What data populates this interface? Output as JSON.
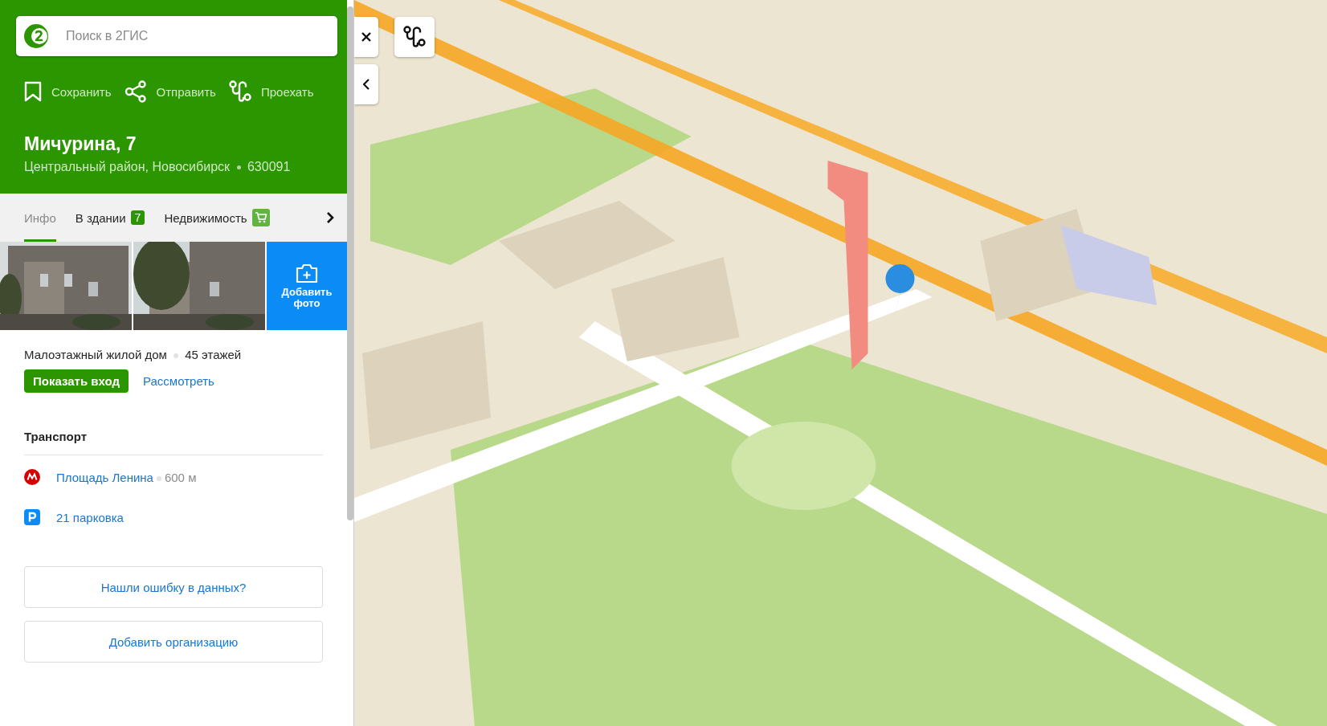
{
  "search": {
    "placeholder": "Поиск в 2ГИС"
  },
  "actions": [
    {
      "kind": "save",
      "label": "Сохранить"
    },
    {
      "kind": "share",
      "label": "Отправить"
    },
    {
      "kind": "route",
      "label": "Проехать"
    }
  ],
  "place": {
    "title": "Мичурина, 7",
    "address": "Центральный район, Новосибирск",
    "postcode": "630091"
  },
  "tabs": [
    {
      "label": "Инфо",
      "selected": true
    },
    {
      "label": "В здании",
      "selected": false,
      "badge": {
        "kind": "count",
        "text": "7"
      }
    },
    {
      "label": "Недвижимость",
      "selected": false,
      "badge": {
        "kind": "cart"
      }
    }
  ],
  "add_photo": "Добавить фото",
  "building": {
    "type": "Малоэтажный жилой дом",
    "floors": "45 этажей"
  },
  "entrance_buttons": [
    {
      "kind": "primary",
      "label": "Показать вход"
    },
    {
      "kind": "link",
      "label": "Рассмотреть"
    }
  ],
  "transport": {
    "title": "Транспорт",
    "items": [
      {
        "kind": "metro",
        "name": "Площадь Ленина",
        "distance": "600 м"
      },
      {
        "kind": "parking",
        "name": "21 парковка"
      }
    ]
  },
  "footer_buttons": [
    "Нашли ошибку в данных?",
    "Добавить организацию"
  ]
}
